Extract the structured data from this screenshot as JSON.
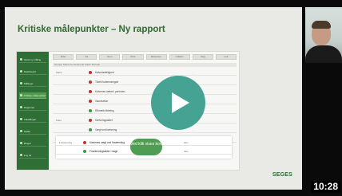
{
  "slide": {
    "title": "Kritiske målepunkter – Ny rapport",
    "logo": "SEGES"
  },
  "app": {
    "sidebar": [
      "Opret ny måling",
      "Dashboard",
      "Målinger",
      "Kritiske målepunkter",
      "Rapporter",
      "Indstillinger",
      "Hjælp",
      "Bruger",
      "Log ud"
    ],
    "toolbar": [
      "Filter",
      "Vis",
      "Gem",
      "Print",
      "Eksporter",
      "Udskriv",
      "Søg",
      "Luk"
    ],
    "header": "Gruppe    Status    Kontrolpunkt    Værdi    Periode",
    "rows": [
      {
        "group": "Kalve",
        "status": "red",
        "label": "Kalvedødelighed",
        "value": "-"
      },
      {
        "group": "",
        "status": "red",
        "label": "Tildelt fodermængde",
        "value": "-"
      },
      {
        "group": "",
        "status": "red",
        "label": "Kalvenes vækst i perioden",
        "value": "-"
      },
      {
        "group": "",
        "status": "red",
        "label": "Vaccination",
        "value": "-"
      },
      {
        "group": "",
        "status": "green",
        "label": "Råmælk tildeling",
        "value": "-"
      },
      {
        "group": "Kvier",
        "status": "red",
        "label": "Kælvningsalder",
        "value": "-"
      },
      {
        "group": "",
        "status": "green",
        "label": "Vægt ved kælvning",
        "value": "-"
      },
      {
        "group": "",
        "status": "red",
        "label": "Kviernes daglige tilvækst",
        "value": "-"
      }
    ],
    "highlight_rows": [
      {
        "group": "Fravænning",
        "status": "red",
        "label": "Kalvenes vægt ved fravænning",
        "value": "Ikke"
      },
      {
        "group": "",
        "status": "green",
        "label": "Fravænningsalder i dage",
        "value": "Ikke"
      }
    ]
  },
  "bubble": "Ved klik vises kort",
  "video": {
    "duration": "10:28"
  },
  "colors": {
    "title": "#2f6b2f",
    "sidebar": "#2f6f36",
    "play": "#369b8b",
    "status_red": "#c4312b",
    "status_green": "#3a9b45"
  }
}
